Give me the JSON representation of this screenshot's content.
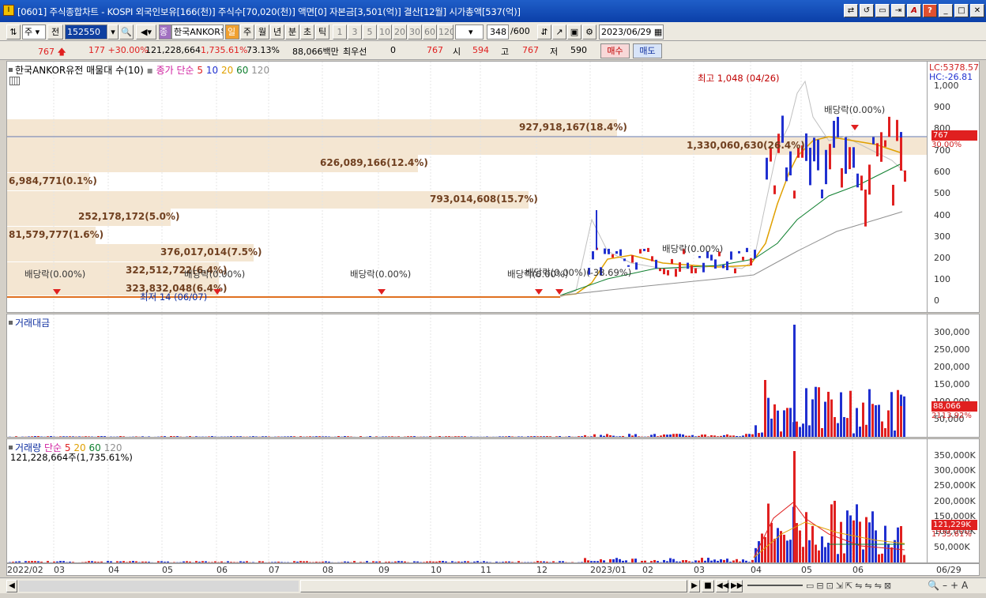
{
  "window": {
    "title": "[0601] 주식종합차트 - KOSPI 외국인보유[166(천)] 주식수[70,020(천)] 액면[0] 자본금[3,501(억)] 결산[12월] 시가총액[537(억)]",
    "buttons": [
      "⇄",
      "↺",
      "▭",
      "⇥",
      "A",
      "?",
      "_",
      "□",
      "✕"
    ]
  },
  "toolbar": {
    "period_unit": "주",
    "prev_label": "전",
    "code": "152550",
    "stock_name": "한국ANKOR유",
    "mode_label": "일",
    "periods": [
      "주",
      "월",
      "년",
      "분",
      "초",
      "틱"
    ],
    "intervals": [
      "1",
      "3",
      "5",
      "10",
      "20",
      "30",
      "60",
      "120"
    ],
    "count": "348",
    "count_total": "/600",
    "date": "2023/06/29"
  },
  "quote": {
    "price": "767",
    "change": "177",
    "change_pct": "+30.00%",
    "volume": "121,228,664",
    "volume_pct": "1,735.61%",
    "turnover": "73.13%",
    "amount": "88,066백만",
    "priority_label": "최우선",
    "priority_val": "0",
    "priority_price": "767",
    "open_label": "시",
    "open": "594",
    "high_label": "고",
    "high": "767",
    "low_label": "저",
    "low": "590",
    "buy": "매수",
    "sell": "매도"
  },
  "price_panel": {
    "title": "한국ANKOR유전 매물대 수(10)",
    "ma_label": "종가 단순",
    "ma_periods": [
      "5",
      "10",
      "20",
      "60",
      "120"
    ],
    "lc": "LC:5378.57",
    "hc": "HC:-26.81",
    "ylabels": [
      "1,000",
      "900",
      "800",
      "700",
      "600",
      "500",
      "400",
      "300",
      "200",
      "100",
      "0"
    ],
    "price_tag": "767",
    "price_sub": "30.00%",
    "high_annot": "최고 1,048 (04/26)",
    "low_annot": "최저 14 (06/07)",
    "dividends": [
      "배당락(0.00%)",
      "배당락(0.00%)",
      "배당락(0.00%)",
      "배당락(0.00%)",
      "배당락(0.00%)",
      "배당락(0.00%)"
    ],
    "extra_annot": "배당락(0.00%)(-38.69%)",
    "volume_profile": [
      "927,918,167(18.4%)",
      "1,330,060,630(26.4%)",
      "626,089,166(12.4%)",
      "6,984,771(0.1%)",
      "793,014,608(15.7%)",
      "252,178,172(5.0%)",
      "81,579,777(1.6%)",
      "376,017,014(7.5%)",
      "322,512,722(6.4%)",
      "323,832,048(6.4%)"
    ]
  },
  "amount_panel": {
    "title": "거래대금",
    "ylabels": [
      "300,000",
      "250,000",
      "200,000",
      "150,000",
      "100,000",
      "50,000"
    ],
    "tag": "88,066",
    "sub": "2113.92%"
  },
  "volume_panel": {
    "title_a": "거래량",
    "title_b": "단순",
    "ma_periods": [
      "5",
      "20",
      "60",
      "120"
    ],
    "info": "121,228,664주(1,735.61%)",
    "ylabels": [
      "350,000K",
      "300,000K",
      "250,000K",
      "200,000K",
      "150,000K",
      "100,000K",
      "50,000K"
    ],
    "tag": "121,229K",
    "sub": "1735.61%"
  },
  "time_axis": {
    "labels": [
      "2022/02",
      "03",
      "04",
      "05",
      "06",
      "07",
      "08",
      "09",
      "10",
      "11",
      "12",
      "2023/01",
      "02",
      "03",
      "04",
      "05",
      "06"
    ],
    "right": "06/29"
  },
  "colors": {
    "up": "#e02020",
    "down": "#2030d0",
    "ma5": "#e02020",
    "ma20": "#e0a000",
    "ma60": "#108030",
    "ma120": "#909090"
  }
}
